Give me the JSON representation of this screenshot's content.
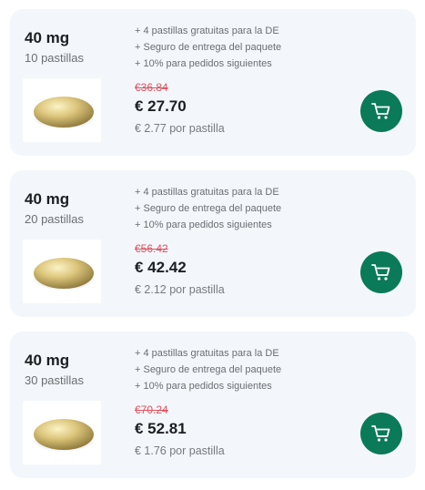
{
  "colors": {
    "card_background": "#f3f7fb",
    "accent": "#0a7a58",
    "old_price": "#e0525e"
  },
  "products": [
    {
      "dose": "40 mg",
      "count": "10 pastillas",
      "benefits": [
        "+ 4 pastillas gratuitas para la DE",
        "+ Seguro de entrega del paquete",
        "+ 10% para pedidos siguientes"
      ],
      "old_price": "€36.84",
      "price": "€ 27.70",
      "per_pill": "€ 2.77 por pastilla",
      "image_icon": "pill-image",
      "cart_icon": "cart-icon"
    },
    {
      "dose": "40 mg",
      "count": "20 pastillas",
      "benefits": [
        "+ 4 pastillas gratuitas para la DE",
        "+ Seguro de entrega del paquete",
        "+ 10% para pedidos siguientes"
      ],
      "old_price": "€56.42",
      "price": "€ 42.42",
      "per_pill": "€ 2.12 por pastilla",
      "image_icon": "pill-image",
      "cart_icon": "cart-icon"
    },
    {
      "dose": "40 mg",
      "count": "30 pastillas",
      "benefits": [
        "+ 4 pastillas gratuitas para la DE",
        "+ Seguro de entrega del paquete",
        "+ 10% para pedidos siguientes"
      ],
      "old_price": "€70.24",
      "price": "€ 52.81",
      "per_pill": "€ 1.76 por pastilla",
      "image_icon": "pill-image",
      "cart_icon": "cart-icon"
    }
  ]
}
